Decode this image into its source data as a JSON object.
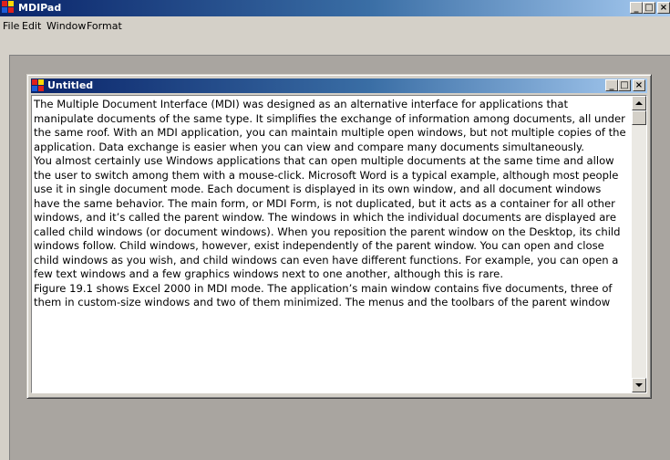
{
  "main_window": {
    "title": "MDIPad",
    "caption_buttons": {
      "minimize": "_",
      "maximize": "□",
      "close": "×"
    }
  },
  "menu": {
    "items": [
      "File",
      "Edit",
      "Window",
      "Format"
    ]
  },
  "child_window": {
    "title": "Untitled",
    "caption_buttons": {
      "minimize": "_",
      "maximize": "□",
      "close": "×"
    }
  },
  "editor": {
    "paragraphs": [
      "The Multiple Document Interface (MDI) was designed as an alternative interface for applications that manipulate documents of the same type. It simplifies the exchange of information among documents, all under the same roof. With an MDI application, you can maintain multiple open windows, but not multiple copies of the application. Data exchange is easier when you can view and compare many documents simultaneously.",
      "You almost certainly use Windows applications that can open multiple documents at the same time and allow the user to switch among them with a mouse-click. Microsoft Word is a typical example, although most people use it in single document mode. Each document is displayed in its own window, and all document windows have the same behavior. The main form, or MDI Form, is not duplicated, but it acts as a container for all other windows, and it’s called the parent window. The windows in which the individual documents are displayed are called child windows (or document windows). When you reposition the parent window on the Desktop, its child windows follow. Child windows, however, exist independently of the parent window. You can open and close child windows as you wish, and child windows can even have different functions. For example, you can open a few text windows and a few graphics windows next to one another, although this is rare.",
      "Figure 19.1 shows Excel 2000 in MDI mode. The application’s main window contains five documents, three of them in custom-size windows and two of them minimized. The menus and the toolbars of the parent window"
    ]
  },
  "colors": {
    "titlebar_active_start": "#0a246a",
    "titlebar_active_end": "#a6caf0",
    "window_face": "#d4d0c8",
    "mdi_client": "#a9a5a0"
  },
  "icons": {
    "app": "mdi-app-icon",
    "scroll_up": "arrow-up-icon",
    "scroll_down": "arrow-down-icon"
  }
}
